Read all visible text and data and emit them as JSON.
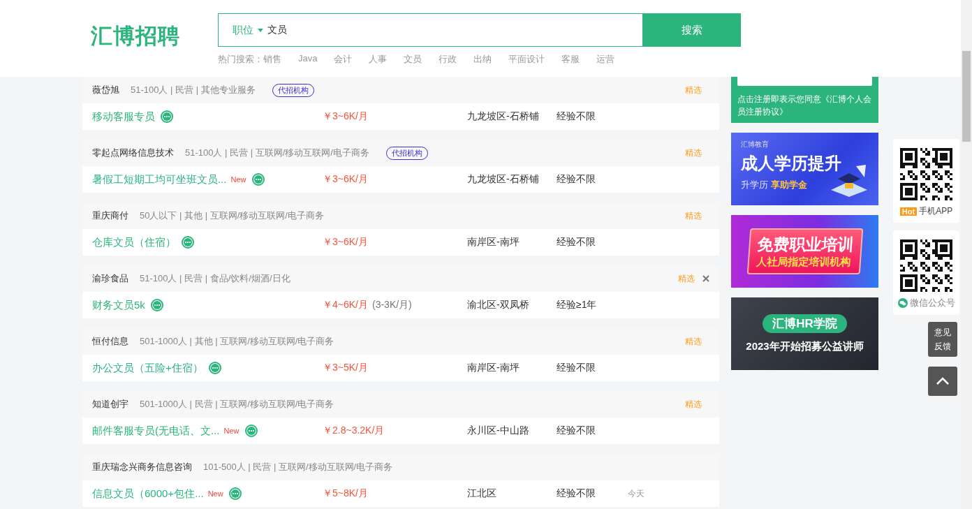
{
  "header": {
    "logo": "汇博招聘",
    "search": {
      "category": "职位",
      "value": "文员",
      "button": "搜索"
    },
    "hot_search": {
      "label": "热门搜索：",
      "items": [
        "销售",
        "Java",
        "会计",
        "人事",
        "文员",
        "行政",
        "出纳",
        "平面设计",
        "客服",
        "运营"
      ]
    }
  },
  "jobs": [
    {
      "company": "薇岱旭",
      "info": "51-100人 | 民营 | 其他专业服务",
      "agency_tag": "代招机构",
      "featured": "精选",
      "closable": false,
      "title": "移动客服专员",
      "salary": "￥3~6K/月",
      "location": "九龙坡区-石桥铺",
      "experience": "经验不限"
    },
    {
      "company": "零起点网络信息技术",
      "info": "51-100人 | 民营 | 互联网/移动互联网/电子商务",
      "agency_tag": "代招机构",
      "featured": "精选",
      "closable": false,
      "title": "暑假工短期工均可坐班文员...",
      "new_badge": "New",
      "salary": "￥3~6K/月",
      "location": "九龙坡区-石桥铺",
      "experience": "经验不限"
    },
    {
      "company": "重庆商付",
      "info": "50人以下 | 其他 | 互联网/移动互联网/电子商务",
      "featured": "精选",
      "closable": false,
      "title": "仓库文员（住宿）",
      "salary": "￥3~6K/月",
      "location": "南岸区-南坪",
      "experience": "经验不限"
    },
    {
      "company": "渝珍食品",
      "info": "51-100人 | 民营 | 食品/饮料/烟酒/日化",
      "featured": "精选",
      "closable": true,
      "title": "财务文员5k",
      "salary": "￥4~6K/月",
      "salary_note": "(3-3K/月)",
      "location": "渝北区-双凤桥",
      "experience": "经验≥1年"
    },
    {
      "company": "恒付信息",
      "info": "501-1000人 | 其他 | 互联网/移动互联网/电子商务",
      "featured": "精选",
      "closable": false,
      "title": "办公文员（五险+住宿）",
      "salary": "￥3~5K/月",
      "location": "南岸区-南坪",
      "experience": "经验不限"
    },
    {
      "company": "知道创宇",
      "info": "501-1000人 | 民营 | 互联网/移动互联网/电子商务",
      "featured": "精选",
      "closable": false,
      "title": "邮件客服专员(无电话、文...",
      "new_badge": "New",
      "salary": "￥2.8~3.2K/月",
      "location": "永川区-中山路",
      "experience": "经验不限"
    },
    {
      "company": "重庆瑞念兴商务信息咨询",
      "info": "101-500人 | 民营 | 互联网/移动互联网/电子商务",
      "closable": false,
      "title": "信息文员（6000+包住...",
      "new_badge": "New",
      "salary": "￥5~8K/月",
      "location": "江北区",
      "experience": "经验不限",
      "date": "今天"
    }
  ],
  "sidebar": {
    "register_agreement": "点击注册即表示您同意《汇博个人会员注册协议》",
    "banners": [
      {
        "kind": "education",
        "brand": "汇博教育",
        "title": "成人学历提升",
        "subtitle": "升学历",
        "highlight": "享助学金"
      },
      {
        "kind": "training",
        "title": "免费职业培训",
        "subtitle": "人社局指定培训机构"
      },
      {
        "kind": "academy",
        "title": "汇博HR学院",
        "subtitle": "2023年开始招募公益讲师"
      }
    ]
  },
  "float_widgets": {
    "qr_cards": [
      {
        "kind": "app",
        "badge": "Hot",
        "label": "手机APP"
      },
      {
        "kind": "wechat",
        "label": "微信公众号"
      }
    ],
    "feedback": "意见反馈"
  }
}
